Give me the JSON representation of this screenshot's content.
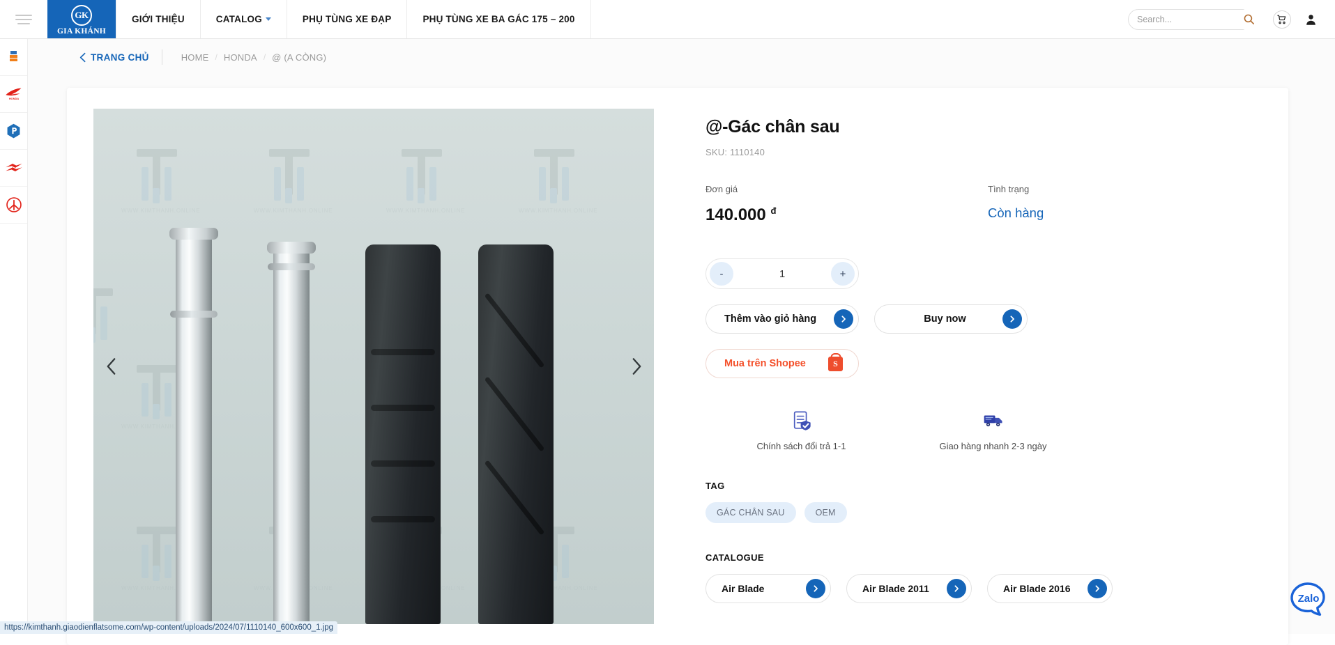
{
  "header": {
    "menu_icon": "hamburger-icon",
    "logo": {
      "mark": "GK",
      "name": "GIA KHÁNH"
    },
    "nav": [
      {
        "label": "GIỚI THIỆU",
        "has_caret": false
      },
      {
        "label": "CATALOG",
        "has_caret": true
      },
      {
        "label": "PHỤ TÙNG XE ĐẠP",
        "has_caret": false
      },
      {
        "label": "PHỤ TÙNG XE BA GÁC 175 – 200",
        "has_caret": false
      }
    ],
    "search": {
      "value": "",
      "placeholder": "Search..."
    },
    "cart_icon": "shopping-cart-icon",
    "user_icon": "user-account-icon"
  },
  "rail": {
    "items": [
      {
        "name": "brand-logo-kimthanh",
        "title": "Kim Thành"
      },
      {
        "name": "brand-logo-honda",
        "title": "Honda"
      },
      {
        "name": "brand-logo-piaggio",
        "title": "Piaggio"
      },
      {
        "name": "brand-logo-suzuki",
        "title": "Suzuki"
      },
      {
        "name": "brand-logo-yamaha",
        "title": "Yamaha"
      }
    ]
  },
  "breadcrumb": {
    "home_label": "TRANG CHỦ",
    "trail": [
      "HOME",
      "HONDA",
      "@ (A CÒNG)"
    ]
  },
  "gallery": {
    "prev_label": "‹",
    "next_label": "›",
    "watermark_text": "WWW.KIMTHANH.ONLINE"
  },
  "product": {
    "title": "@-Gác chân sau",
    "sku": "SKU: 1110140",
    "price_label": "Đơn giá",
    "price_value": "140.000",
    "price_currency": "đ",
    "stock_label": "Tình trạng",
    "stock_value": "Còn hàng",
    "qty": {
      "minus": "-",
      "value": "1",
      "plus": "+"
    },
    "add_to_cart": "Thêm vào giỏ hàng",
    "buy_now": "Buy now",
    "shopee": "Mua trên Shopee",
    "promos": [
      {
        "icon": "return-policy-icon",
        "label": "Chính sách đổi trả 1-1"
      },
      {
        "icon": "fast-delivery-truck-icon",
        "label": "Giao hàng nhanh 2-3 ngày"
      }
    ],
    "tag_heading": "TAG",
    "tags": [
      "GÁC CHÂN SAU",
      "OEM"
    ],
    "catalogue_heading": "CATALOGUE",
    "catalogue": [
      "Air Blade",
      "Air Blade 2011",
      "Air Blade 2016"
    ]
  },
  "zalo": {
    "label": "Zalo"
  },
  "statusbar": {
    "url": "https://kimthanh.giaodienflatsome.com/wp-content/uploads/2024/07/1110140_600x600_1.jpg"
  },
  "colors": {
    "brand_blue": "#1565b8",
    "shopee_orange": "#ee4d2d",
    "tag_bg": "#e3eefa"
  }
}
